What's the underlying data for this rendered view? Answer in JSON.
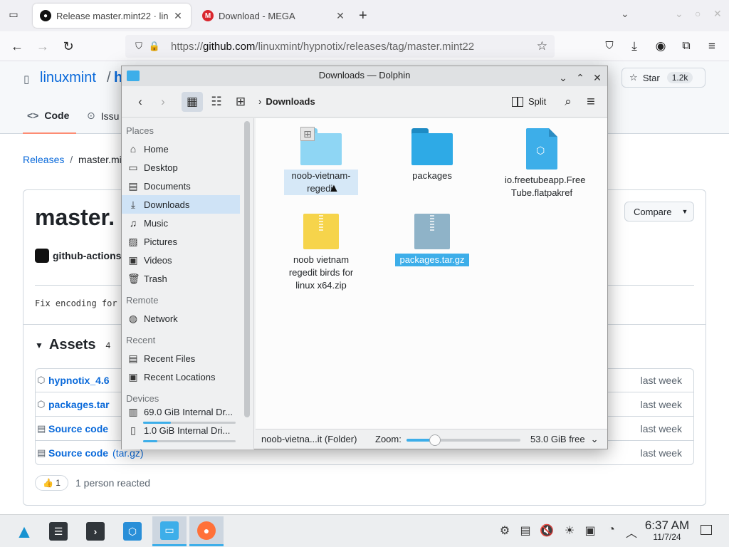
{
  "browser": {
    "tabs": [
      {
        "title": "Release master.mint22 · lin",
        "active": true
      },
      {
        "title": "Download - MEGA",
        "active": false
      }
    ],
    "url_prefix": "https://",
    "url_domain": "github.com",
    "url_path": "/linuxmint/hypnotix/releases/tag/master.mint22"
  },
  "github": {
    "owner": "linuxmint",
    "sep": "/",
    "repo_fragment": "h",
    "star_label": "Star",
    "star_count": "1.2k",
    "tab_code": "Code",
    "tab_issues": "Issu",
    "breadcrumb_link": "Releases",
    "breadcrumb_sep": "/",
    "breadcrumb_current": "master.min",
    "release_title": "master.",
    "actor": "github-actions",
    "body_text": "Fix encoding for",
    "compare_label": "Compare",
    "assets_title": "Assets",
    "assets_count": "4",
    "assets": [
      {
        "name": "hypnotix_4.6",
        "date": "last week",
        "icon": "package-icon"
      },
      {
        "name": "packages.tar",
        "date": "last week",
        "icon": "package-icon"
      },
      {
        "name": "Source code",
        "suffix": "",
        "date": "last week",
        "icon": "file-zip-icon"
      },
      {
        "name": "Source code",
        "suffix": "(tar.gz)",
        "date": "last week",
        "icon": "file-zip-icon"
      }
    ],
    "reaction_emoji": "👍",
    "reaction_count": "1",
    "reacted_text": "1 person reacted"
  },
  "dolphin": {
    "window_title": "Downloads — Dolphin",
    "breadcrumb": "Downloads",
    "split_label": "Split",
    "places_heading": "Places",
    "places": [
      {
        "label": "Home",
        "icon": "home-icon"
      },
      {
        "label": "Desktop",
        "icon": "desktop-icon"
      },
      {
        "label": "Documents",
        "icon": "documents-icon"
      },
      {
        "label": "Downloads",
        "icon": "downloads-icon",
        "selected": true
      },
      {
        "label": "Music",
        "icon": "music-icon"
      },
      {
        "label": "Pictures",
        "icon": "pictures-icon"
      },
      {
        "label": "Videos",
        "icon": "videos-icon"
      },
      {
        "label": "Trash",
        "icon": "trash-icon"
      }
    ],
    "remote_heading": "Remote",
    "remote": [
      {
        "label": "Network",
        "icon": "network-icon"
      }
    ],
    "recent_heading": "Recent",
    "recent": [
      {
        "label": "Recent Files",
        "icon": "recent-files-icon"
      },
      {
        "label": "Recent Locations",
        "icon": "recent-locations-icon"
      }
    ],
    "devices_heading": "Devices",
    "devices": [
      {
        "label": "69.0 GiB Internal Dr...",
        "usage": 0.3
      },
      {
        "label": "1.0 GiB Internal Dri...",
        "usage": 0.15
      }
    ],
    "files": [
      {
        "name": "noob-vietnam-regedit",
        "line1": "noob-vietnam-",
        "line2": "regedit",
        "type": "folder",
        "state": "hover"
      },
      {
        "name": "packages",
        "line1": "packages",
        "line2": "",
        "type": "folder",
        "state": "none"
      },
      {
        "name": "io.freetubeapp.FreeTube.flatpakref",
        "line1": "io.freetubeapp.Free",
        "line2": "Tube.flatpakref",
        "type": "flatpakref",
        "state": "none"
      },
      {
        "name": "noob vietnam regedit birds for linux x64.zip",
        "line1": "noob vietnam",
        "line2": "regedit birds for",
        "line3": "linux x64.zip",
        "type": "zip",
        "state": "none"
      },
      {
        "name": "packages.tar.gz",
        "line1": "packages.tar.gz",
        "line2": "",
        "type": "targz",
        "state": "selected"
      }
    ],
    "status_info": "noob-vietna...it (Folder)",
    "zoom_label": "Zoom:",
    "zoom_level": 0.25,
    "free_space": "53.0 GiB free"
  },
  "taskbar": {
    "time": "6:37 AM",
    "date": "11/7/24"
  },
  "colors": {
    "accent": "#3daee9",
    "github_link": "#0969da",
    "folder_blue": "#5fc1ec",
    "zip_yellow": "#f6d44b",
    "targz_gray": "#8fb3c8"
  }
}
